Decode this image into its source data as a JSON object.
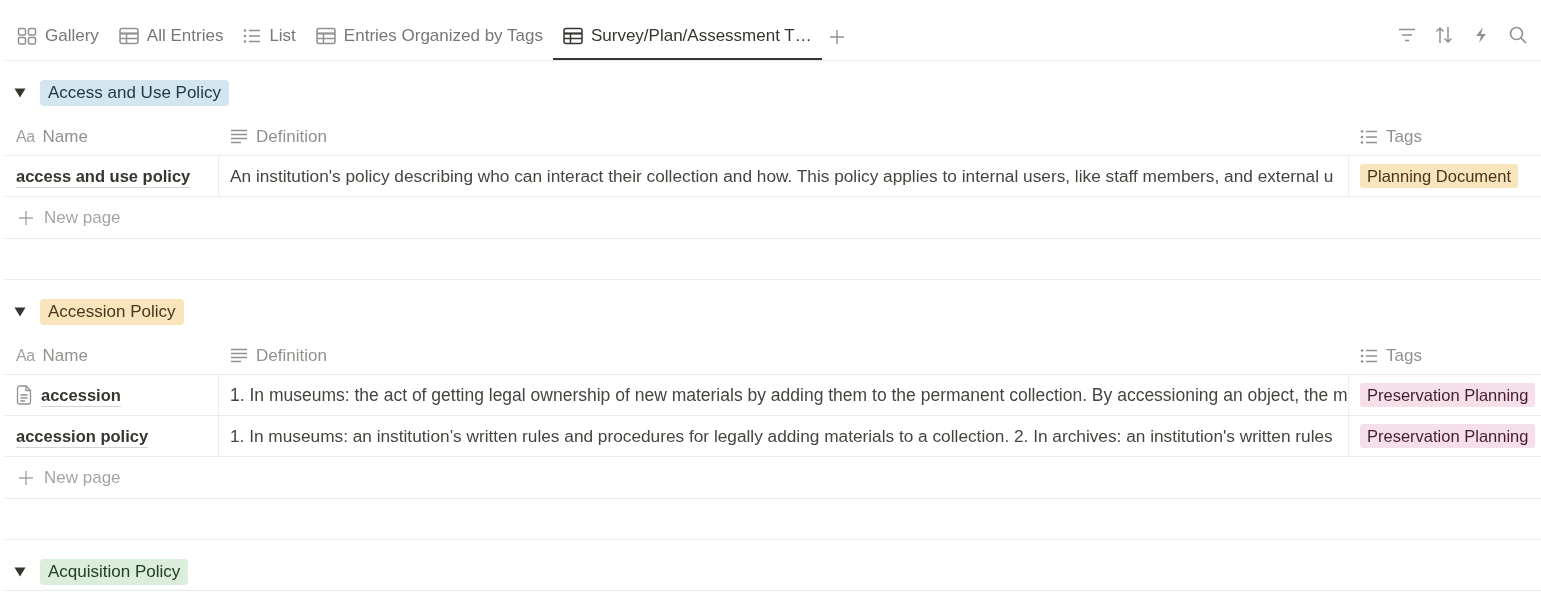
{
  "view_tabs": [
    {
      "label": "Gallery",
      "kind": "gallery",
      "selected": false
    },
    {
      "label": "All Entries",
      "kind": "table",
      "selected": false
    },
    {
      "label": "List",
      "kind": "list",
      "selected": false
    },
    {
      "label": "Entries Organized by Tags",
      "kind": "table",
      "selected": false
    },
    {
      "label": "Survey/Plan/Assessment T…",
      "kind": "table",
      "selected": true
    }
  ],
  "groups": [
    {
      "label": "Access and Use Policy",
      "color": "#d3e5ef",
      "expanded": true,
      "columns": [
        {
          "label": "Name",
          "kind": "title",
          "glyph": "Aa"
        },
        {
          "label": "Definition",
          "kind": "text"
        },
        {
          "label": "Tags",
          "kind": "multi_select"
        }
      ],
      "rows": [
        {
          "name": "access and use policy",
          "page_icon": false,
          "definition": "An institution's policy describing who can interact their collection and how. This policy applies to internal users, like staff members, and external u",
          "tags": [
            {
              "label": "Planning Document",
              "color": "#f9e4bc"
            }
          ]
        }
      ],
      "new_page": "New page"
    },
    {
      "label": "Accession Policy",
      "color": "#f9e4bc",
      "expanded": true,
      "columns": [
        {
          "label": "Name",
          "kind": "title",
          "glyph": "Aa"
        },
        {
          "label": "Definition",
          "kind": "text"
        },
        {
          "label": "Tags",
          "kind": "multi_select"
        }
      ],
      "rows": [
        {
          "name": "accession",
          "page_icon": true,
          "definition": "1. In museums: the act of getting legal ownership of new materials by adding them to the permanent collection. By accessioning an object, the m",
          "tags": [
            {
              "label": "Preservation Planning",
              "color": "#f5e0e9"
            }
          ]
        },
        {
          "name": "accession policy",
          "page_icon": false,
          "definition": "1. In museums: an institution’s written rules and procedures for legally adding materials to a collection. 2. In archives: an institution's written rules",
          "tags": [
            {
              "label": "Preservation Planning",
              "color": "#f5e0e9"
            }
          ]
        }
      ],
      "new_page": "New page"
    },
    {
      "label": "Acquisition Policy",
      "color": "#dbeddb",
      "expanded": true
    }
  ]
}
